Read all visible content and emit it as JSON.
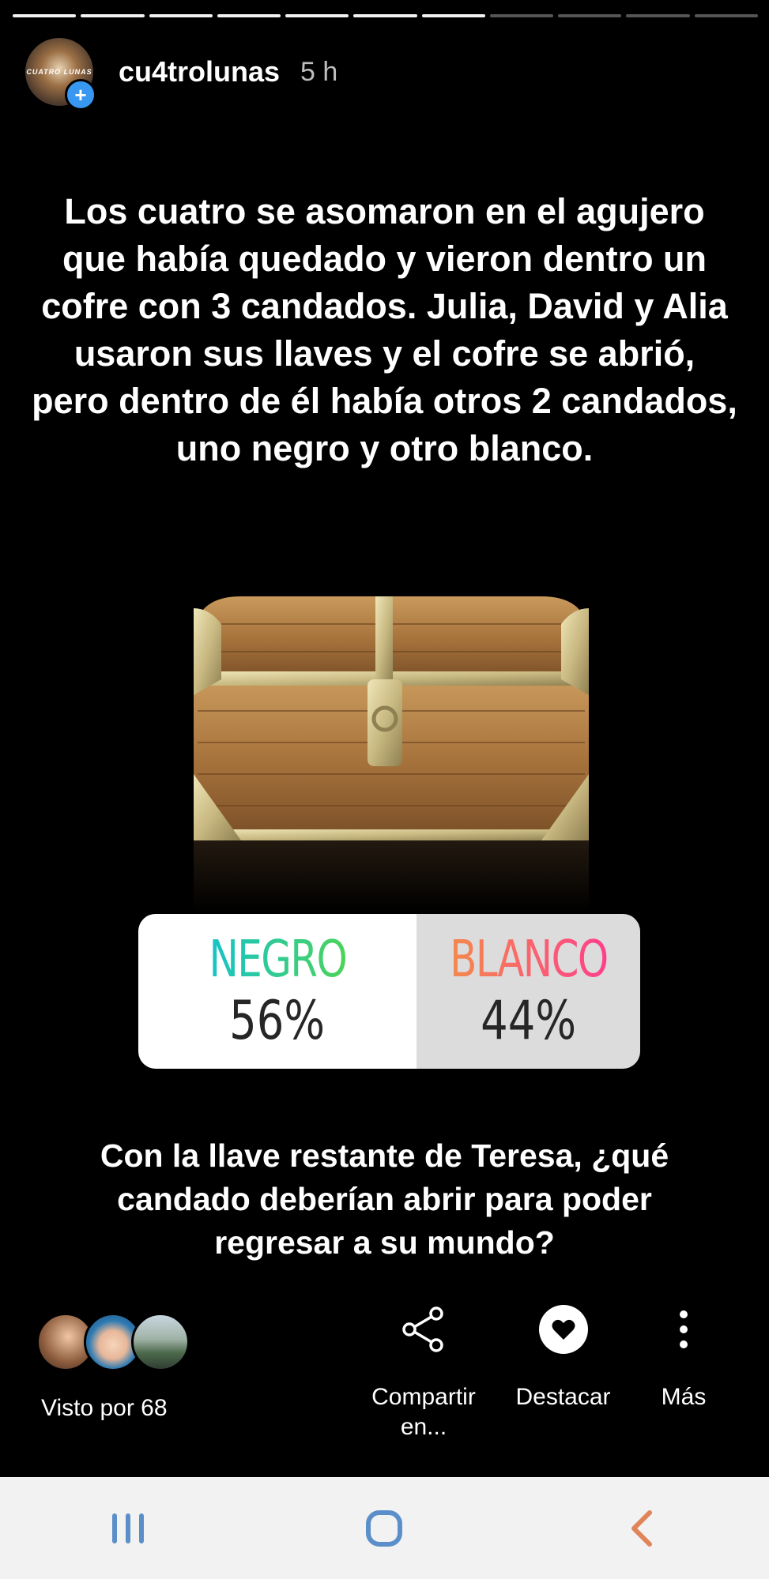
{
  "progress": {
    "total": 11,
    "completed": 7
  },
  "header": {
    "avatar_text": "CUATRO LUNAS",
    "username": "cu4trolunas",
    "time": "5 h",
    "avatar_icon": "add-plus-icon"
  },
  "story_text": "Los cuatro se asomaron en el agujero que había quedado y vieron dentro un cofre con 3 candados. Julia, David y Alia usaron sus llaves y el cofre se abrió, pero dentro de él había otros 2 candados, uno negro y otro blanco.",
  "poll": {
    "option_a": {
      "label": "NEGRO",
      "percent": "56%"
    },
    "option_b": {
      "label": "BLANCO",
      "percent": "44%"
    }
  },
  "question": "Con la llave restante de Teresa, ¿qué candado deberían abrir para poder regresar a su mundo?",
  "footer": {
    "seen_label": "Visto por 68",
    "share_label": "Compartir en...",
    "highlight_label": "Destacar",
    "more_label": "Más"
  },
  "navbar": {
    "recents_icon": "recent-apps-icon",
    "home_icon": "home-icon",
    "back_icon": "back-icon",
    "accent_color": "#5b8fc9"
  }
}
